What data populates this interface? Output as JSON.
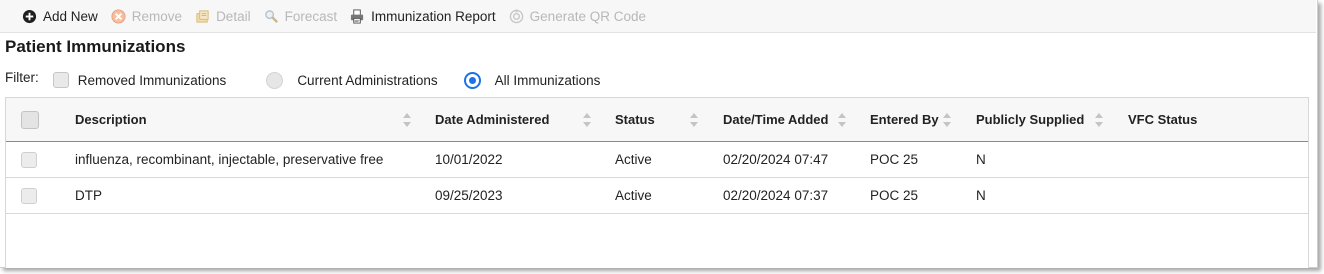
{
  "toolbar": {
    "items": [
      {
        "label": "Add New",
        "icon": "plus-circle-icon",
        "enabled": true
      },
      {
        "label": "Remove",
        "icon": "remove-icon",
        "enabled": false
      },
      {
        "label": "Detail",
        "icon": "detail-icon",
        "enabled": false
      },
      {
        "label": "Forecast",
        "icon": "magnifier-icon",
        "enabled": false
      },
      {
        "label": "Immunization Report",
        "icon": "printer-icon",
        "enabled": true
      },
      {
        "label": "Generate QR Code",
        "icon": "qr-code-icon",
        "enabled": false
      }
    ]
  },
  "page": {
    "title": "Patient Immunizations"
  },
  "filter": {
    "label": "Filter:",
    "options": [
      {
        "label": "Removed Immunizations",
        "type": "checkbox",
        "checked": false
      },
      {
        "label": "Current Administrations",
        "type": "radio",
        "checked": false
      },
      {
        "label": "All Immunizations",
        "type": "radio",
        "checked": true
      }
    ]
  },
  "grid": {
    "columns": [
      "Description",
      "Date Administered",
      "Status",
      "Date/Time Added",
      "Entered By",
      "Publicly Supplied",
      "VFC Status"
    ],
    "rows": [
      [
        "influenza, recombinant, injectable, preservative free",
        "10/01/2022",
        "Active",
        "02/20/2024 07:47",
        "POC 25",
        "N",
        ""
      ],
      [
        "DTP",
        "09/25/2023",
        "Active",
        "02/20/2024 07:37",
        "POC 25",
        "N",
        ""
      ]
    ]
  },
  "colors": {
    "accent": "#1a73e8",
    "add_icon": "#1f1f1f",
    "remove_icon": "#e8a07a",
    "disabled_text": "#b8b8b8"
  }
}
